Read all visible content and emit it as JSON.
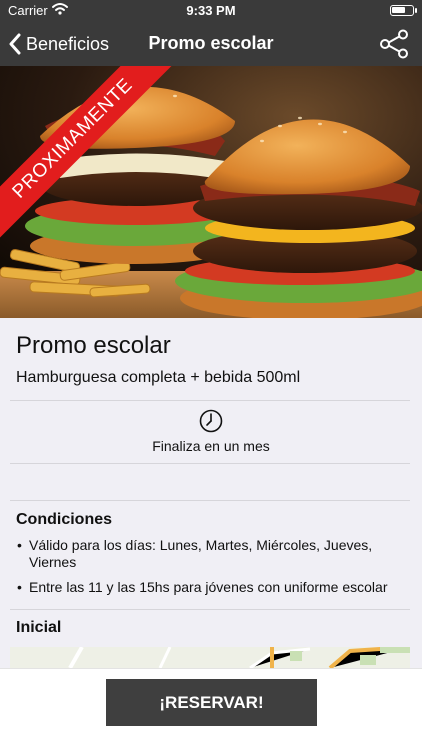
{
  "status": {
    "carrier": "Carrier",
    "time": "9:33 PM",
    "battery_level": 0.7
  },
  "nav": {
    "back_label": "Beneficios",
    "title": "Promo escolar",
    "back_icon": "chevron-left-icon",
    "share_icon": "share-icon"
  },
  "hero": {
    "ribbon_text": "PROXIMAMENTE",
    "ribbon_color": "#e21d1d"
  },
  "promo": {
    "title": "Promo escolar",
    "subtitle": "Hamburguesa completa + bebida 500ml",
    "ends_text": "Finaliza en un mes",
    "clock_icon": "clock-icon"
  },
  "conditions": {
    "title": "Condiciones",
    "items": [
      "Válido para los días: Lunes, Martes, Miércoles, Jueves, Viernes",
      "Entre las 11 y las 15hs para jóvenes con uniforme escolar"
    ]
  },
  "location": {
    "title": "Inicial"
  },
  "cta": {
    "label": "¡RESERVAR!"
  },
  "colors": {
    "nav_bg": "#3a3a3a",
    "button_bg": "#3f3f3f",
    "page_bg": "#f0eff5"
  }
}
